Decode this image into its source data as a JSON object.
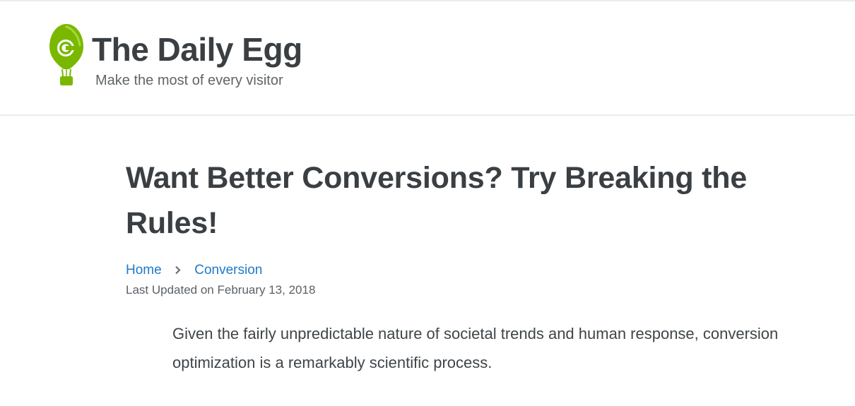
{
  "site": {
    "name": "The Daily Egg",
    "tagline": "Make the most of every visitor",
    "brand_color": "#7ab800",
    "logo_icon": "balloon-egg-logo-icon"
  },
  "article": {
    "title": "Want Better Conversions? Try Breaking the Rules!",
    "breadcrumb": {
      "home_label": "Home",
      "separator_icon": "chevron-right-icon",
      "category_label": "Conversion"
    },
    "updated_prefix": "Last Updated on ",
    "updated_date": "February 13, 2018",
    "intro": "Given the fairly unpredictable nature of societal trends and human response, conversion optimization is a remarkably scientific process."
  },
  "colors": {
    "link": "#1f7ac9",
    "heading": "#3a3f43"
  }
}
